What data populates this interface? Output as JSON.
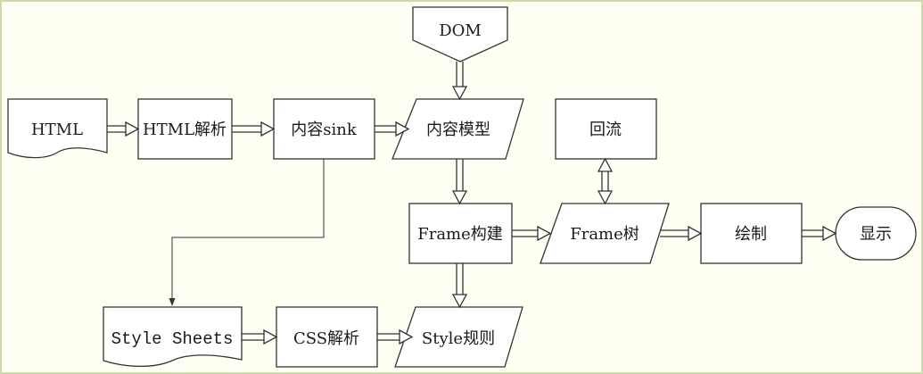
{
  "diagram": {
    "nodes": {
      "dom": "DOM",
      "html": "HTML",
      "html_parse": "HTML解析",
      "content_sink": "内容sink",
      "content_model": "内容模型",
      "reflow": "回流",
      "frame_build": "Frame构建",
      "frame_tree": "Frame树",
      "paint": "绘制",
      "display": "显示",
      "style_sheets": "Style Sheets",
      "css_parse": "CSS解析",
      "style_rules": "Style规则"
    },
    "colors": {
      "background": "#fffff4",
      "stroke": "#333333",
      "fill": "#ffffff"
    }
  }
}
